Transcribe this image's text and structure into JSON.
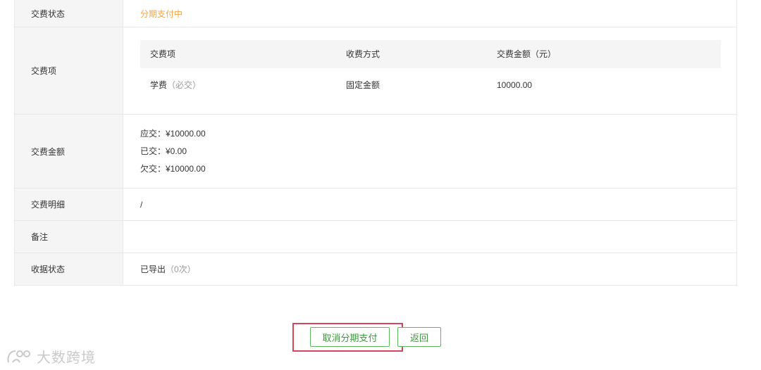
{
  "detail": {
    "status_label": "交费状态",
    "status_value": "分期支付中",
    "items_label": "交费项",
    "items_table": {
      "headers": [
        "交费项",
        "收费方式",
        "交费金额（元）"
      ],
      "rows": [
        {
          "name": "学费",
          "note": "（必交）",
          "method": "固定金额",
          "amount": "10000.00"
        }
      ]
    },
    "amount_label": "交费金额",
    "amount_due": "应交：¥10000.00",
    "amount_paid": "已交：¥0.00",
    "amount_owed": "欠交：¥10000.00",
    "breakdown_label": "交费明细",
    "breakdown_value": "/",
    "remarks_label": "备注",
    "remarks_value": "",
    "receipt_label": "收据状态",
    "receipt_value": "已导出",
    "receipt_count": "（0次）"
  },
  "actions": {
    "cancel_installment": "取消分期支付",
    "back": "返回"
  },
  "watermark": {
    "text": "大数跨境"
  },
  "colors": {
    "accent_green": "#5cb85c",
    "status_orange": "#f0a54a",
    "highlight_red": "#d2455a"
  }
}
